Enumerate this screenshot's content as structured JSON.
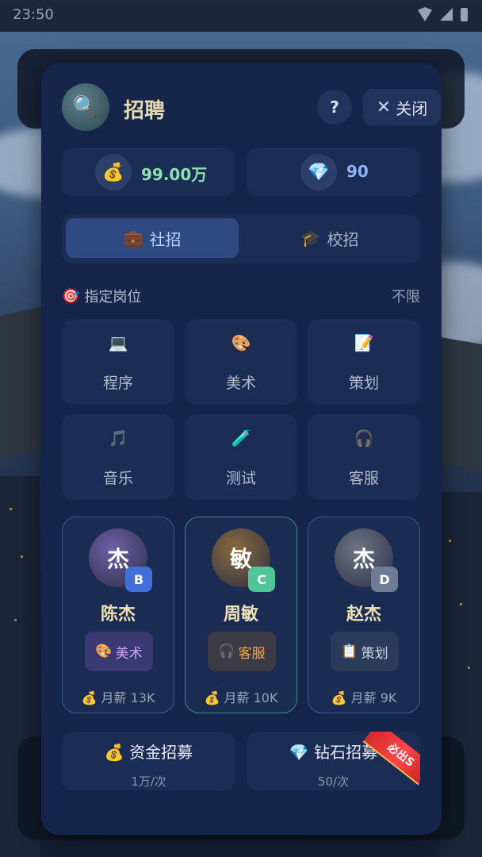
{
  "status": {
    "time": "23:50"
  },
  "dialog": {
    "title": "招聘",
    "help_label": "?",
    "close_label": "关闭"
  },
  "currency": {
    "money": {
      "icon": "💰",
      "value": "99.00万"
    },
    "diamond": {
      "icon": "💎",
      "value": "90"
    }
  },
  "tabs": [
    {
      "icon": "💼",
      "label": "社招",
      "active": true
    },
    {
      "icon": "🎓",
      "label": "校招",
      "active": false
    }
  ],
  "section": {
    "icon": "🎯",
    "label": "指定岗位",
    "right": "不限"
  },
  "jobs": [
    {
      "icon": "💻",
      "label": "程序"
    },
    {
      "icon": "🎨",
      "label": "美术"
    },
    {
      "icon": "📝",
      "label": "策划"
    },
    {
      "icon": "🎵",
      "label": "音乐"
    },
    {
      "icon": "🧪",
      "label": "测试"
    },
    {
      "icon": "🎧",
      "label": "客服"
    }
  ],
  "candidates": [
    {
      "avatar": "杰",
      "grade": "B",
      "name": "陈杰",
      "skill_icon": "🎨",
      "skill": "美术",
      "salary": "💰 月薪 13K",
      "avatar_color": "#6f5fa8",
      "grade_color": "#3f6fd8",
      "skill_bg": "#3a3a73",
      "skill_color": "#c9a6ff"
    },
    {
      "avatar": "敏",
      "grade": "C",
      "name": "周敏",
      "skill_icon": "🎧",
      "skill": "客服",
      "salary": "💰 月薪 10K",
      "avatar_color": "#8a6a3c",
      "grade_color": "#4fc59a",
      "skill_bg": "#3b3a45",
      "skill_color": "#f0a850"
    },
    {
      "avatar": "杰",
      "grade": "D",
      "name": "赵杰",
      "skill_icon": "📋",
      "skill": "策划",
      "salary": "💰 月薪 9K",
      "avatar_color": "#6f7582",
      "grade_color": "#6e7b94",
      "skill_bg": "#2d3b5a",
      "skill_color": "#c8d2e6"
    }
  ],
  "recruit": {
    "money": {
      "title": "💰 资金招募",
      "cost": "1万/次"
    },
    "diamond": {
      "title": "💎 钻石招募",
      "cost": "50/次",
      "ribbon": "必出S"
    }
  }
}
